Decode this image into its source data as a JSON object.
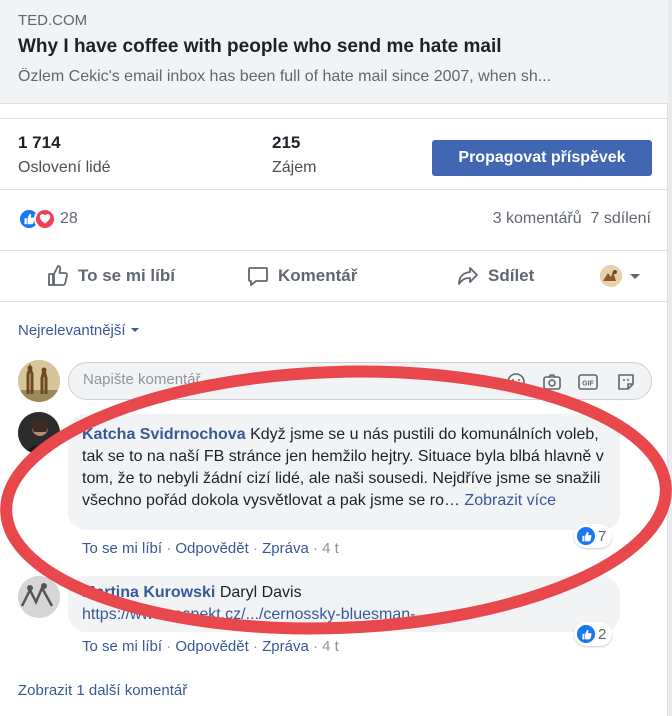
{
  "preview": {
    "domain": "TED.COM",
    "title": "Why I have coffee with people who send me hate mail",
    "description": "Özlem Cekic's email inbox has been full of hate mail since 2007, when sh..."
  },
  "stats": {
    "reach_value": "1 714",
    "reach_label": "Oslovení lidé",
    "engagement_value": "215",
    "engagement_label": "Zájem",
    "promote_label": "Propagovat příspěvek"
  },
  "reactions": {
    "count": "28",
    "comments": "3 komentářů",
    "shares": "7 sdílení"
  },
  "actions": {
    "like": "To se mi líbí",
    "comment": "Komentář",
    "share": "Sdílet"
  },
  "sort_label": "Nejrelevantnější",
  "composer": {
    "placeholder": "Napište komentář..."
  },
  "comments": [
    {
      "author": "Katcha Svidrnochova",
      "text": "Když jsme se u nás pustili do komunálních voleb, tak se to na naší FB stránce jen hemžilo hejtry. Situace byla blbá hlavně v tom, že to nebyli žádní cizí lidé, ale naši sousedi. Nejdříve jsme se snažili všechno pořád dokola vysvětlovat a pak jsme se ro…",
      "see_more": "Zobrazit více",
      "like": "To se mi líbí",
      "reply": "Odpovědět",
      "report": "Zpráva",
      "time": "4 t",
      "likes": "7"
    },
    {
      "author": "Martina Kurowski",
      "text": "Daryl Davis",
      "url": "https://www.respekt.cz/.../cernossky-bluesman-...",
      "like": "To se mi líbí",
      "reply": "Odpovědět",
      "report": "Zpráva",
      "time": "4 t",
      "likes": "2"
    }
  ],
  "more_comments": "Zobrazit 1 další komentář",
  "colors": {
    "brand": "#4267b2",
    "link": "#385898",
    "like_blue": "#1877f2",
    "love_red": "#f33e58",
    "annotation_red": "#e8474c"
  }
}
